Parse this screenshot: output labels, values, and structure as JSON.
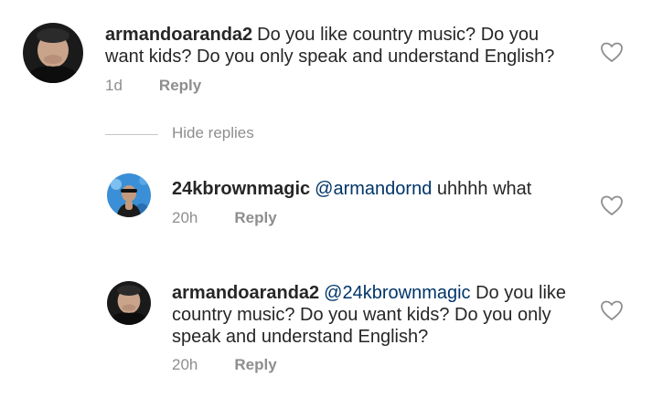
{
  "comments": [
    {
      "username": "armandoaranda2",
      "mention": "",
      "text": "Do you like country music? Do you want kids? Do you only speak and understand English?",
      "time": "1d",
      "reply_label": "Reply",
      "avatar_icon": "profile-avatar-dark"
    },
    {
      "username": "24kbrownmagic",
      "mention": "@armandornd",
      "text": "uhhhh what",
      "time": "20h",
      "reply_label": "Reply",
      "avatar_icon": "profile-avatar-blue"
    },
    {
      "username": "armandoaranda2",
      "mention": "@24kbrownmagic",
      "text": "Do you like country music? Do you want kids? Do you only speak and understand English?",
      "time": "20h",
      "reply_label": "Reply",
      "avatar_icon": "profile-avatar-dark"
    }
  ],
  "hide_replies_label": "Hide replies",
  "colors": {
    "text": "#262626",
    "mention": "#003569",
    "meta": "#8e8e8e",
    "heart_outline": "#8e8e8e"
  },
  "icons": {
    "like": "heart-outline-icon"
  }
}
